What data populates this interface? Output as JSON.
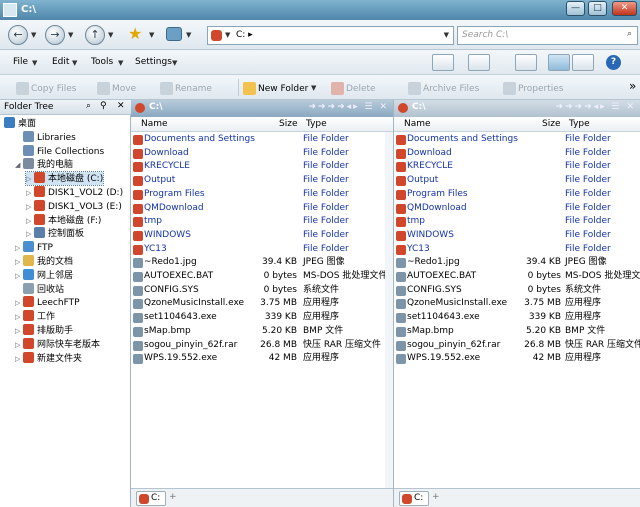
{
  "window": {
    "title": "C:\\",
    "controls": {
      "minimize": "—",
      "maximize": "□",
      "close": "✕"
    }
  },
  "address": {
    "path": "C: ▸",
    "search_placeholder": "Search C:\\"
  },
  "menu": {
    "items": [
      "File",
      "Edit",
      "Tools",
      "Settings"
    ]
  },
  "toolbar": {
    "copy": "Copy Files",
    "move": "Move",
    "rename": "Rename",
    "new_folder": "New Folder",
    "delete": "Delete",
    "archive": "Archive Files",
    "properties": "Properties",
    "overflow": "»"
  },
  "tree": {
    "header": "Folder Tree",
    "nodes": [
      {
        "label": "桌面",
        "level": 0
      },
      {
        "label": "Libraries",
        "level": 1
      },
      {
        "label": "File Collections",
        "level": 1
      },
      {
        "label": "我的电脑",
        "level": 1
      },
      {
        "label": "本地磁盘 (C:)",
        "level": 2
      },
      {
        "label": "DISK1_VOL2 (D:)",
        "level": 2
      },
      {
        "label": "DISK1_VOL3 (E:)",
        "level": 2
      },
      {
        "label": "本地磁盘 (F:)",
        "level": 2
      },
      {
        "label": "控制面板",
        "level": 2
      },
      {
        "label": "FTP",
        "level": 1
      },
      {
        "label": "我的文档",
        "level": 1
      },
      {
        "label": "网上邻居",
        "level": 1
      },
      {
        "label": "回收站",
        "level": 1
      },
      {
        "label": "LeechFTP",
        "level": 1
      },
      {
        "label": "工作",
        "level": 1
      },
      {
        "label": "排版助手",
        "level": 1
      },
      {
        "label": "网际快车老版本",
        "level": 1
      },
      {
        "label": "新建文件夹",
        "level": 1
      }
    ]
  },
  "pane_left": {
    "title": "C:\\",
    "tab": "C:",
    "tab_plus": "+"
  },
  "pane_right": {
    "title": "C:\\",
    "tab": "C:",
    "tab_plus": "+"
  },
  "columns": {
    "name": "Name",
    "size": "Size",
    "type": "Type"
  },
  "files": [
    {
      "name": "Documents and Settings",
      "size": "",
      "type": "File Folder",
      "folder": true
    },
    {
      "name": "Download",
      "size": "",
      "type": "File Folder",
      "folder": true
    },
    {
      "name": "KRECYCLE",
      "size": "",
      "type": "File Folder",
      "folder": true
    },
    {
      "name": "Output",
      "size": "",
      "type": "File Folder",
      "folder": true
    },
    {
      "name": "Program Files",
      "size": "",
      "type": "File Folder",
      "folder": true
    },
    {
      "name": "QMDownload",
      "size": "",
      "type": "File Folder",
      "folder": true
    },
    {
      "name": "tmp",
      "size": "",
      "type": "File Folder",
      "folder": true
    },
    {
      "name": "WINDOWS",
      "size": "",
      "type": "File Folder",
      "folder": true
    },
    {
      "name": "YC13",
      "size": "",
      "type": "File Folder",
      "folder": true
    },
    {
      "name": "~Redo1.jpg",
      "size": "39.4 KB",
      "type": "JPEG 图像",
      "folder": false
    },
    {
      "name": "AUTOEXEC.BAT",
      "size": "0 bytes",
      "type": "MS-DOS 批处理文件",
      "folder": false
    },
    {
      "name": "CONFIG.SYS",
      "size": "0 bytes",
      "type": "系统文件",
      "folder": false
    },
    {
      "name": "QzoneMusicInstall.exe",
      "size": "3.75 MB",
      "type": "应用程序",
      "folder": false
    },
    {
      "name": "set1104643.exe",
      "size": "339 KB",
      "type": "应用程序",
      "folder": false
    },
    {
      "name": "sMap.bmp",
      "size": "5.20 KB",
      "type": "BMP 文件",
      "folder": false
    },
    {
      "name": "sogou_pinyin_62f.rar",
      "size": "26.8 MB",
      "type": "快压 RAR 压缩文件",
      "folder": false
    },
    {
      "name": "WPS.19.552.exe",
      "size": "42 MB",
      "type": "应用程序",
      "folder": false
    }
  ],
  "colors": {
    "title_bar": "#4f86aa",
    "folder_text": "#1433a8",
    "accent_red": "#d0472c"
  }
}
